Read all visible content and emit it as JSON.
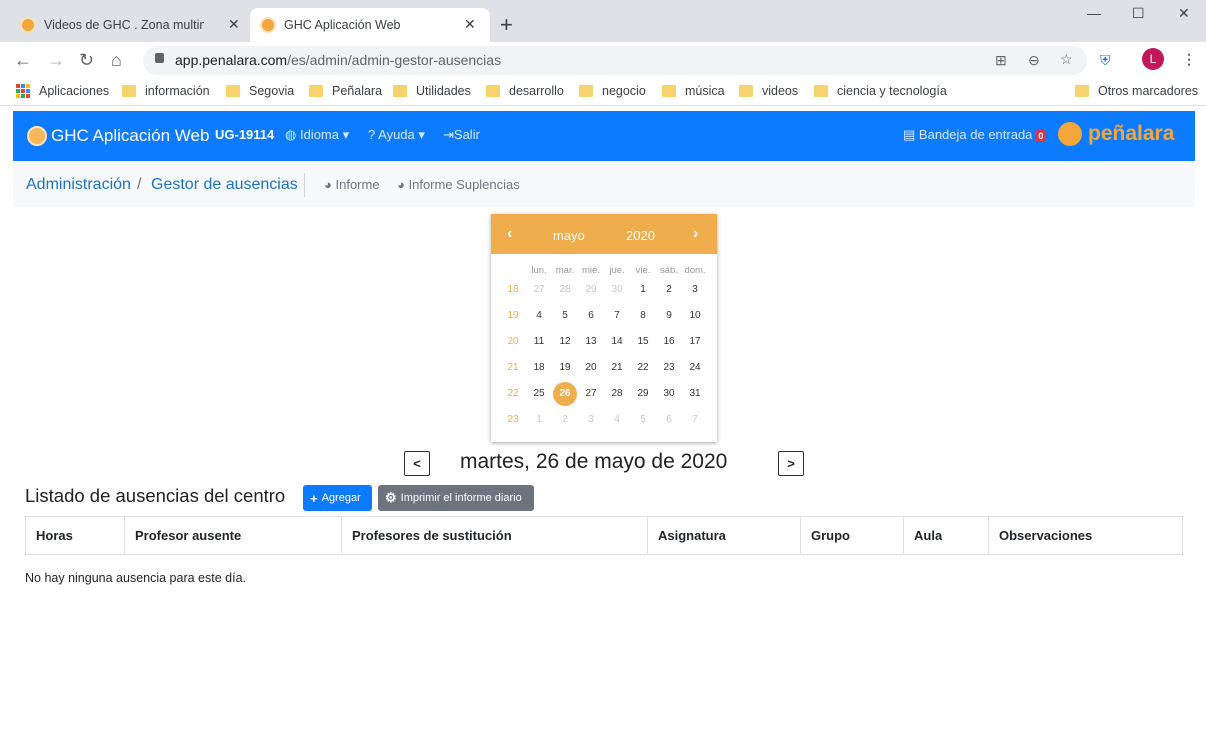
{
  "browser": {
    "tabs": [
      {
        "title": "Videos de GHC . Zona multimedia",
        "close": "✕"
      },
      {
        "title": "GHC Aplicación Web",
        "close": "✕"
      }
    ],
    "new_tab": "+",
    "url_host": "app.penalara.com",
    "url_path": "/es/admin/admin-gestor-ausencias",
    "avatar_letter": "L",
    "bookmarks": [
      "Aplicaciones",
      "información",
      "Segovia",
      "Peñalara",
      "Utilidades",
      "desarrollo",
      "negocio",
      "música",
      "videos",
      "ciencia y tecnología",
      "Otros marcadores"
    ]
  },
  "nav": {
    "brand": "GHC Aplicación Web",
    "code": "UG-19114",
    "idioma": "Idioma",
    "ayuda": "Ayuda",
    "salir": "Salir",
    "bandeja": "Bandeja de entrada",
    "bandeja_count": "0",
    "logo_text": "peñalara"
  },
  "breadcrumb": {
    "admin": "Administración",
    "sep": "/",
    "current": "Gestor de ausencias",
    "informe": "Informe",
    "informe_suplencias": "Informe Suplencias"
  },
  "calendar": {
    "prev": "‹",
    "next": "›",
    "month": "mayo",
    "year": "2020",
    "dow": [
      "lun.",
      "mar.",
      "mié.",
      "jue.",
      "vie.",
      "sáb.",
      "dom."
    ],
    "weeks": [
      {
        "wk": "18",
        "days": [
          "27",
          "28",
          "29",
          "30",
          "1",
          "2",
          "3"
        ],
        "other": [
          0,
          1,
          2,
          3
        ]
      },
      {
        "wk": "19",
        "days": [
          "4",
          "5",
          "6",
          "7",
          "8",
          "9",
          "10"
        ],
        "other": []
      },
      {
        "wk": "20",
        "days": [
          "11",
          "12",
          "13",
          "14",
          "15",
          "16",
          "17"
        ],
        "other": []
      },
      {
        "wk": "21",
        "days": [
          "18",
          "19",
          "20",
          "21",
          "22",
          "23",
          "24"
        ],
        "other": []
      },
      {
        "wk": "22",
        "days": [
          "25",
          "26",
          "27",
          "28",
          "29",
          "30",
          "31"
        ],
        "other": []
      },
      {
        "wk": "23",
        "days": [
          "1",
          "2",
          "3",
          "4",
          "5",
          "6",
          "7"
        ],
        "other": [
          0,
          1,
          2,
          3,
          4,
          5,
          6
        ]
      }
    ],
    "selected": "26"
  },
  "date_title": "martes, 26 de mayo de 2020",
  "listado": {
    "title": "Listado de ausencias del centro",
    "add_label": "Agregar",
    "print_label": "Imprimir el informe diario",
    "columns": [
      "Horas",
      "Profesor ausente",
      "Profesores de sustitución",
      "Asignatura",
      "Grupo",
      "Aula",
      "Observaciones"
    ],
    "empty_text": "No hay ninguna ausencia para este día."
  }
}
